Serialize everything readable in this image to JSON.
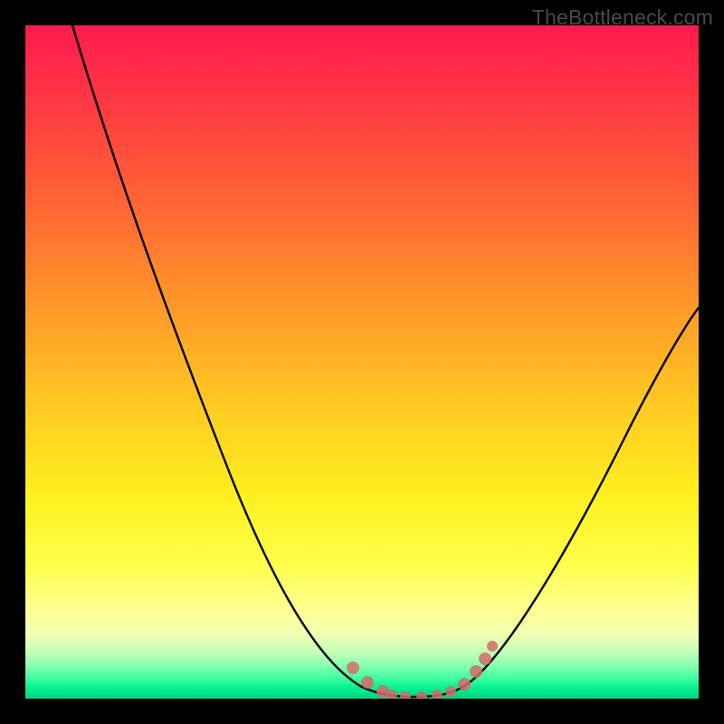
{
  "watermark": "TheBottleneck.com",
  "chart_data": {
    "type": "line",
    "title": "",
    "xlabel": "",
    "ylabel": "",
    "xlim": [
      0,
      100
    ],
    "ylim": [
      0,
      100
    ],
    "background_gradient_stops": [
      {
        "pct": 0,
        "color": "#ff1a4d"
      },
      {
        "pct": 14,
        "color": "#ff4040"
      },
      {
        "pct": 42,
        "color": "#ff9a2a"
      },
      {
        "pct": 70,
        "color": "#fff020"
      },
      {
        "pct": 86,
        "color": "#ffff8a"
      },
      {
        "pct": 95,
        "color": "#8affb0"
      },
      {
        "pct": 100,
        "color": "#00d080"
      }
    ],
    "series": [
      {
        "name": "bottleneck-curve",
        "stroke": "#000000",
        "points_xy": [
          [
            7,
            100
          ],
          [
            16,
            80
          ],
          [
            26,
            56
          ],
          [
            36,
            33
          ],
          [
            44,
            15
          ],
          [
            50,
            5
          ],
          [
            54,
            1
          ],
          [
            58,
            0
          ],
          [
            62,
            0
          ],
          [
            66,
            1
          ],
          [
            70,
            4
          ],
          [
            76,
            12
          ],
          [
            84,
            28
          ],
          [
            92,
            45
          ],
          [
            100,
            58
          ]
        ]
      }
    ],
    "markers": {
      "name": "highlight-dots",
      "color": "#d66a6a",
      "points_xy": [
        [
          50,
          5
        ],
        [
          52,
          3
        ],
        [
          55,
          1
        ],
        [
          56,
          0.5
        ],
        [
          59,
          0
        ],
        [
          62,
          0
        ],
        [
          65,
          0.5
        ],
        [
          67,
          2
        ],
        [
          68,
          4
        ],
        [
          69,
          6
        ],
        [
          70,
          8
        ]
      ]
    }
  }
}
